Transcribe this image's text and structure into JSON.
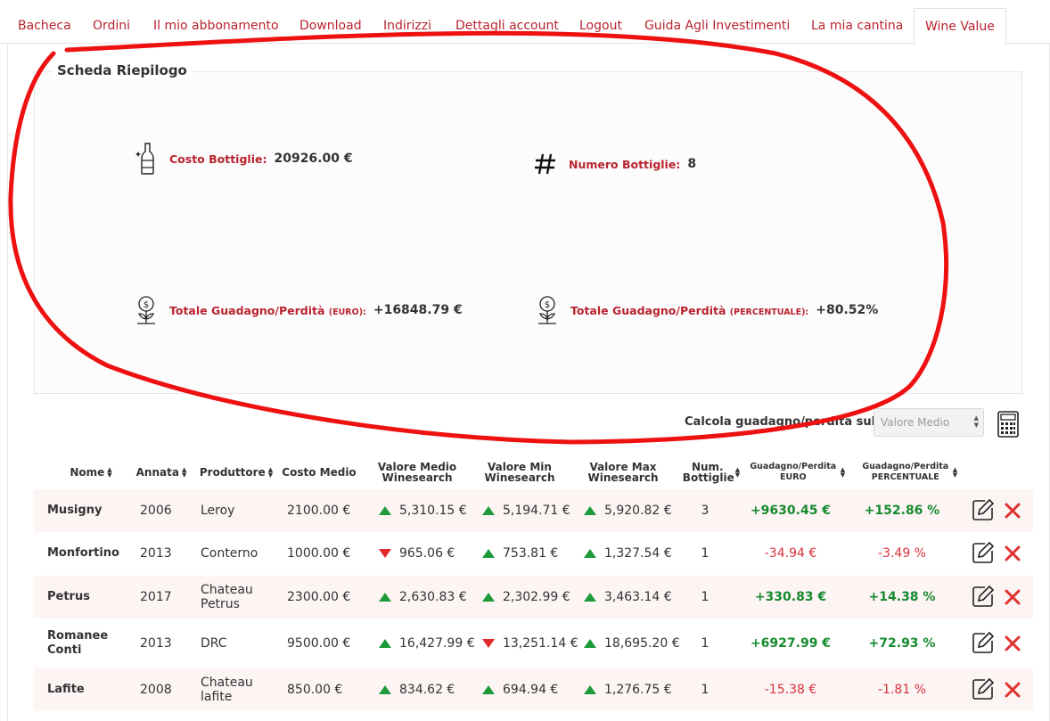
{
  "tabs": [
    {
      "label": "Bacheca"
    },
    {
      "label": "Ordini"
    },
    {
      "label": "Il mio abbonamento"
    },
    {
      "label": "Download"
    },
    {
      "label": "Indirizzi"
    },
    {
      "label": "Dettagli account"
    },
    {
      "label": "Logout"
    },
    {
      "label": "Guida Agli Investimenti"
    },
    {
      "label": "La mia cantina"
    },
    {
      "label": "Wine Value"
    }
  ],
  "summary": {
    "title": "Scheda Riepilogo",
    "costo": {
      "label": "Costo Bottiglie:",
      "value": "20926.00 €"
    },
    "numero": {
      "label": "Numero Bottiglie:",
      "value": "8"
    },
    "guadagno_euro": {
      "label": "Totale Guadagno/Perdità",
      "unit": "(EURO):",
      "value": "+16848.79 €"
    },
    "guadagno_perc": {
      "label": "Totale Guadagno/Perdità",
      "unit": "(PERCENTUALE):",
      "value": "+80.52%"
    }
  },
  "calc": {
    "label": "Calcola guadagno/perdita sul",
    "selected": "Valore Medio"
  },
  "table": {
    "headers": {
      "nome": "Nome",
      "annata": "Annata",
      "produttore": "Produttore",
      "costo": "Costo Medio",
      "medio": "Valore Medio Winesearch",
      "min": "Valore Min Winesearch",
      "max": "Valore Max Winesearch",
      "num": "Num. Bottiglie",
      "g_euro": "Guadagno/Perdita EURO",
      "g_perc": "Guadagno/Perdita PERCENTUALE"
    },
    "rows": [
      {
        "nome": "Musigny",
        "annata": "2006",
        "produttore": "Leroy",
        "costo": "2100.00 €",
        "medio": "5,310.15 €",
        "medio_trend": "up",
        "min": "5,194.71 €",
        "min_trend": "up",
        "max": "5,920.82 €",
        "max_trend": "up",
        "num": "3",
        "g_euro": "+9630.45 €",
        "g_perc": "+152.86 %",
        "sign": "pos"
      },
      {
        "nome": "Monfortino",
        "annata": "2013",
        "produttore": "Conterno",
        "costo": "1000.00 €",
        "medio": "965.06 €",
        "medio_trend": "down",
        "min": "753.81 €",
        "min_trend": "up",
        "max": "1,327.54 €",
        "max_trend": "up",
        "num": "1",
        "g_euro": "-34.94 €",
        "g_perc": "-3.49 %",
        "sign": "neg"
      },
      {
        "nome": "Petrus",
        "annata": "2017",
        "produttore": "Chateau Petrus",
        "costo": "2300.00 €",
        "medio": "2,630.83 €",
        "medio_trend": "up",
        "min": "2,302.99 €",
        "min_trend": "up",
        "max": "3,463.14 €",
        "max_trend": "up",
        "num": "1",
        "g_euro": "+330.83 €",
        "g_perc": "+14.38 %",
        "sign": "pos"
      },
      {
        "nome": "Romanee Conti",
        "annata": "2013",
        "produttore": "DRC",
        "costo": "9500.00 €",
        "medio": "16,427.99 €",
        "medio_trend": "up",
        "min": "13,251.14 €",
        "min_trend": "down",
        "max": "18,695.20 €",
        "max_trend": "up",
        "num": "1",
        "g_euro": "+6927.99 €",
        "g_perc": "+72.93 %",
        "sign": "pos"
      },
      {
        "nome": "Lafite",
        "annata": "2008",
        "produttore": "Chateau lafite",
        "costo": "850.00 €",
        "medio": "834.62 €",
        "medio_trend": "up",
        "min": "694.94 €",
        "min_trend": "up",
        "max": "1,276.75 €",
        "max_trend": "up",
        "num": "1",
        "g_euro": "-15.38 €",
        "g_perc": "-1.81 %",
        "sign": "neg"
      }
    ]
  },
  "colors": {
    "accent": "#b8232f",
    "positive": "#168a2f",
    "negative": "#d8323d",
    "trend_up": "#1e9a3a",
    "trend_down": "#e02a2a",
    "annotation": "#ee1111"
  }
}
